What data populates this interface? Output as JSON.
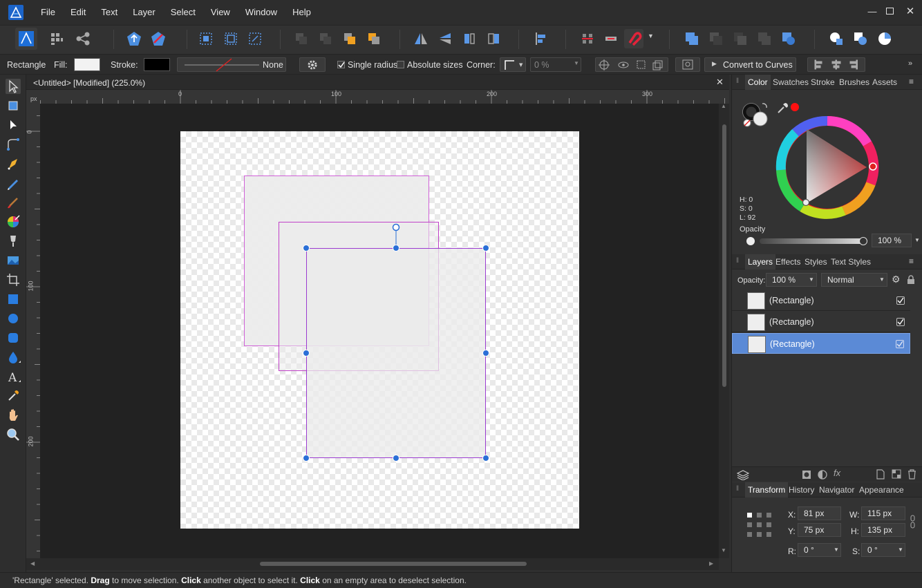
{
  "menubar": {
    "items": [
      "File",
      "Edit",
      "Text",
      "Layer",
      "Select",
      "View",
      "Window",
      "Help"
    ]
  },
  "context_toolbar": {
    "tool_name": "Rectangle",
    "fill_label": "Fill:",
    "stroke_label": "Stroke:",
    "stroke_style": "None",
    "single_radius_label": "Single radius",
    "absolute_sizes_label": "Absolute sizes",
    "corner_label": "Corner:",
    "corner_value": "0 %",
    "convert_label": "Convert to Curves"
  },
  "document": {
    "tab_title": "<Untitled> [Modified] (225.0%)",
    "ruler_unit": "px",
    "h_ticks": [
      "0",
      "100",
      "200",
      "300"
    ],
    "v_ticks": [
      "0",
      "100",
      "200"
    ]
  },
  "color_panel": {
    "tabs": [
      "Color",
      "Swatches",
      "Stroke",
      "Brushes",
      "Assets"
    ],
    "h": "H: 0",
    "s": "S: 0",
    "l": "L: 92",
    "opacity_label": "Opacity",
    "opacity_value": "100 %"
  },
  "layers_panel": {
    "tabs": [
      "Layers",
      "Effects",
      "Styles",
      "Text Styles"
    ],
    "opacity_label": "Opacity:",
    "opacity_value": "100 %",
    "blend_mode": "Normal",
    "layers": [
      "(Rectangle)",
      "(Rectangle)",
      "(Rectangle)"
    ]
  },
  "transform_panel": {
    "tabs": [
      "Transform",
      "History",
      "Navigator",
      "Appearance"
    ],
    "x_label": "X:",
    "x_value": "81 px",
    "y_label": "Y:",
    "y_value": "75 px",
    "w_label": "W:",
    "w_value": "115 px",
    "h_label": "H:",
    "h_value": "135 px",
    "r_label": "R:",
    "r_value": "0 °",
    "s_label": "S:",
    "s_value": "0 °"
  },
  "status": {
    "p1": "'Rectangle' selected. ",
    "b1": "Drag",
    "p2": " to move selection. ",
    "b2": "Click",
    "p3": " another object to select it. ",
    "b3": "Click",
    "p4": " on an empty area to deselect selection."
  },
  "colors": {
    "accent": "#2a6fd6",
    "selection": "#b035c9",
    "layer_selected": "#5b8ad6",
    "stroke_color": "#ff0000"
  }
}
